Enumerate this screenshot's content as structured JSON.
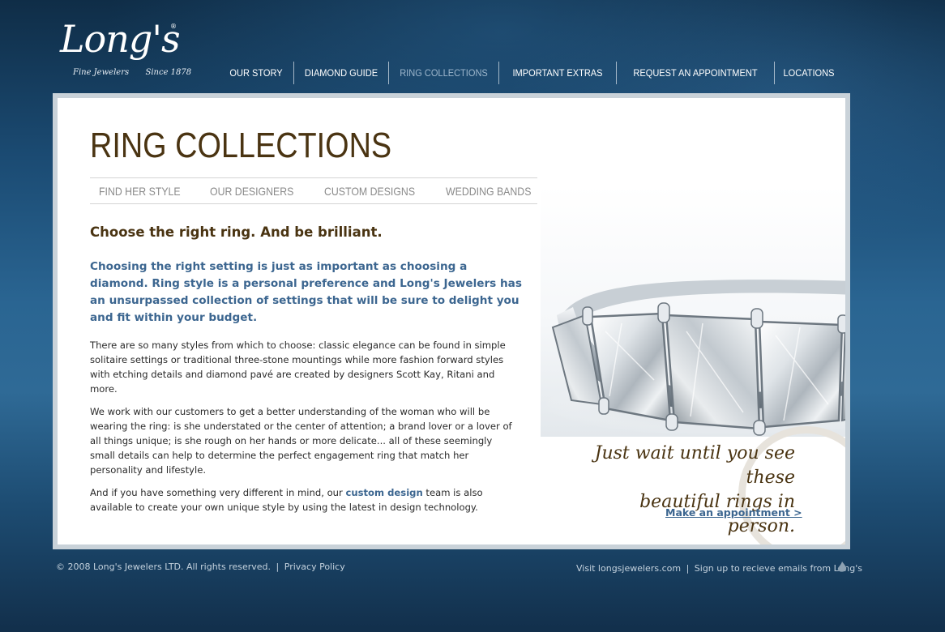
{
  "brand": {
    "logo_text": "Long's",
    "tagline_left": "Fine Jewelers",
    "tagline_right": "Since 1878",
    "registered_mark": "®"
  },
  "nav": {
    "items": [
      {
        "label": "OUR STORY"
      },
      {
        "label": "DIAMOND GUIDE"
      },
      {
        "label": "RING COLLECTIONS"
      },
      {
        "label": "IMPORTANT EXTRAS"
      },
      {
        "label": "REQUEST AN APPOINTMENT"
      },
      {
        "label": "LOCATIONS"
      }
    ],
    "active_index": 2
  },
  "page": {
    "title": "RING COLLECTIONS",
    "subnav": [
      {
        "label": "FIND HER STYLE"
      },
      {
        "label": "OUR DESIGNERS"
      },
      {
        "label": "CUSTOM DESIGNS"
      },
      {
        "label": "WEDDING BANDS"
      }
    ],
    "headline": "Choose the right ring. And be brilliant.",
    "lead": "Choosing the right setting is just as important as choosing a diamond. Ring style is a personal preference and Long's Jewelers has an unsurpassed collection of settings that will be sure to delight you and fit within your budget.",
    "paragraph_1": "There are so many styles from which to choose: classic elegance can be found in simple solitaire settings or traditional three-stone mountings while more fashion forward styles with etching details and diamond pavé are created by designers Scott Kay, Ritani and more.",
    "paragraph_2": "We work with our customers to get a better understanding of the woman who will be wearing the ring: is she understated or the center of attention; a brand lover or a lover of all things unique; is she rough on her hands or more delicate... all of these seemingly small details can help to determine the perfect engagement ring that match her personality and lifestyle.",
    "paragraph_3_before": "And if you have something very different in mind, our ",
    "paragraph_3_link": "custom design",
    "paragraph_3_after": " team is also available to create your own unique style by using the latest in design technology.",
    "promo_line_1": "Just wait until you see these",
    "promo_line_2": "beautiful rings in person.",
    "appointment_link": "Make an appointment >"
  },
  "footer": {
    "copyright": "© 2008 Long's Jewelers LTD. All rights reserved.",
    "privacy": "Privacy Policy",
    "visit": "Visit longsjewelers.com",
    "signup": "Sign up to recieve emails from Long's",
    "separator": "|"
  },
  "colors": {
    "brown": "#4a3412",
    "blue_text": "#3c6690",
    "nav_active": "#9db6cc"
  }
}
